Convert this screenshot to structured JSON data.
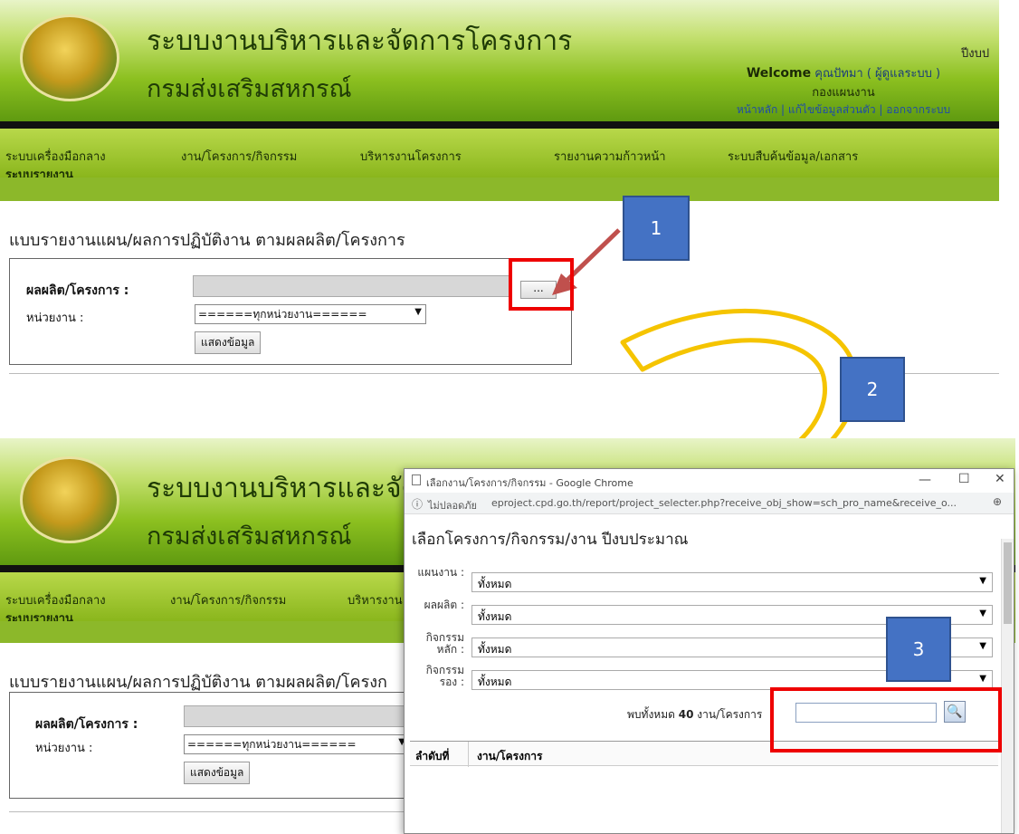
{
  "site": {
    "title": "ระบบงานบริหารและจัดการโครงการ",
    "subtitle": "กรมส่งเสริมสหกรณ์",
    "corner_text": "ปีงบป",
    "welcome_label": "Welcome",
    "welcome_user": "คุณปัทมา ( ผู้ดูแลระบบ )",
    "department": "กองแผนงาน",
    "links": "หน้าหลัก | แก้ไขข้อมูลส่วนตัว | ออกจากระบบ"
  },
  "nav": {
    "items": [
      "ระบบเครื่องมือกลาง",
      "งาน/โครงการ/กิจกรรม",
      "บริหารงานโครงการ",
      "รายงานความก้าวหน้า",
      "ระบบสืบค้นข้อมูล/เอกสาร"
    ],
    "items_short": [
      "ระบบเครื่องมือกลาง",
      "งาน/โครงการ/กิจกรรม",
      "บริหารงาน"
    ],
    "second_row": "ระบบรายงาน"
  },
  "report": {
    "heading": "แบบรายงานแผน/ผลการปฏิบัติงาน ตามผลผลิต/โครงการ",
    "heading_cut": "แบบรายงานแผน/ผลการปฏิบัติงาน ตามผลผลิต/โครงก",
    "project_label": "ผลผลิต/โครงการ :",
    "unit_label": "หน่วยงาน :",
    "unit_value": "======ทุกหน่วยงาน======",
    "browse_label": "...",
    "show_button": "แสดงข้อมูล"
  },
  "callouts": [
    "1",
    "2",
    "3"
  ],
  "popup": {
    "window_title": "เลือกงาน/โครงการ/กิจกรรม - Google Chrome",
    "security": "ไม่ปลอดภัย",
    "url": "eproject.cpd.go.th/report/project_selecter.php?receive_obj_show=sch_pro_name&receive_o...",
    "heading": "เลือกโครงการ/กิจกรรม/งาน ปีงบประมาณ",
    "filters": [
      {
        "label": "แผนงาน :",
        "value": "ทั้งหมด"
      },
      {
        "label": "ผลผลิต :",
        "value": "ทั้งหมด"
      },
      {
        "label": "กิจกรรมหลัก :",
        "value": "ทั้งหมด"
      },
      {
        "label": "กิจกรรมรอง :",
        "value": "ทั้งหมด"
      }
    ],
    "found_prefix": "พบทั้งหมด",
    "found_count": "40",
    "found_suffix": "งาน/โครงการ",
    "col_order": "ลำดับที่",
    "col_project": "งาน/โครงการ"
  },
  "colors": {
    "accent_red": "#e00000",
    "callout_blue": "#4472c4",
    "header_green": "#8cc020"
  }
}
